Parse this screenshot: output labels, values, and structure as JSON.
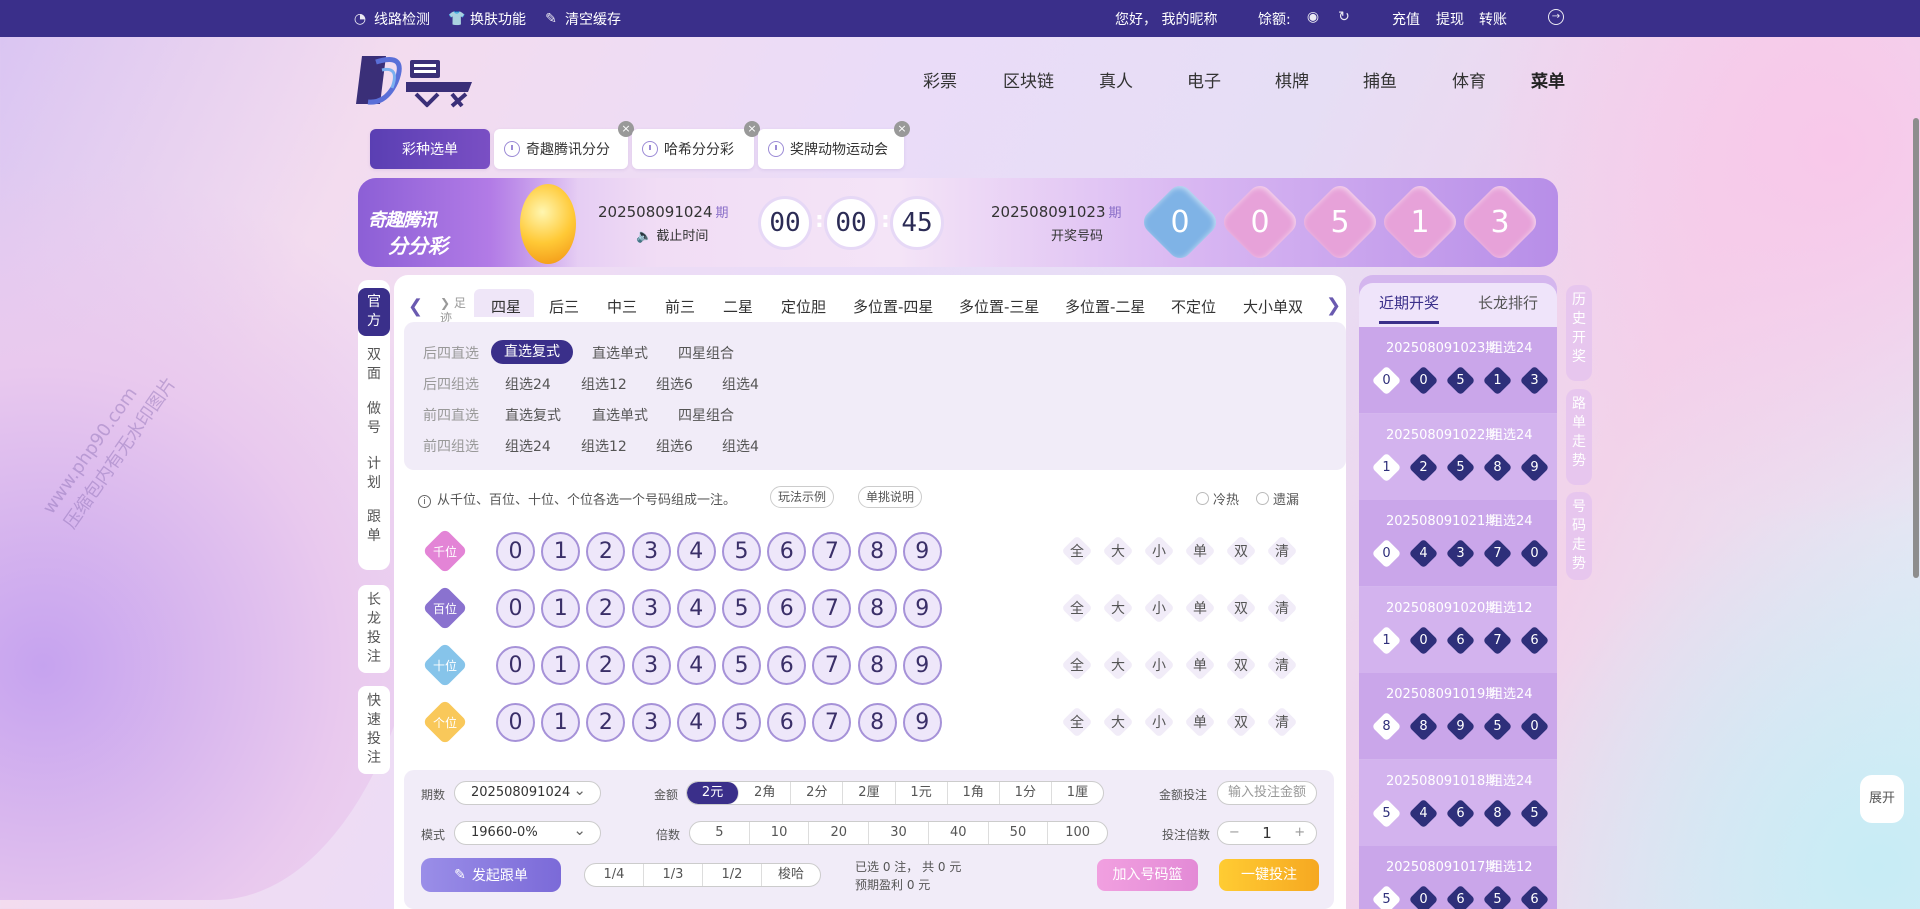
{
  "topbar": {
    "line_check": "线路检测",
    "skin": "换肤功能",
    "clear_cache": "清空缓存",
    "greeting": "您好， 我的昵称",
    "balance_label": "馀额:",
    "recharge": "充值",
    "withdraw": "提现",
    "transfer": "转账"
  },
  "nav": [
    "彩票",
    "区块链",
    "真人",
    "电子",
    "棋牌",
    "捕鱼",
    "体育",
    "菜单"
  ],
  "tabs": {
    "menu": "彩种选单",
    "items": [
      "奇趣腾讯分分",
      "哈希分分彩",
      "奖牌动物运动会"
    ]
  },
  "banner": {
    "logo_line1": "奇趣腾讯",
    "logo_line2": "分分彩",
    "current_issue": "202508091024",
    "issue_suffix": "期",
    "deadline_label": "截止时间",
    "time": [
      "00",
      "00",
      "45"
    ],
    "last_issue": "202508091023",
    "last_label": "开奖号码",
    "draw_numbers": [
      "0",
      "0",
      "5",
      "1",
      "3"
    ],
    "draw_colors": [
      "#7fb3e6",
      "#e7a2d9",
      "#e7a2d9",
      "#e7a2d9",
      "#e7a2d9"
    ]
  },
  "left_side": {
    "active": "官方",
    "items": [
      "双面",
      "做号",
      "计划",
      "跟单"
    ],
    "long_bet": "长龙投注",
    "quick_bet": "快速投注"
  },
  "play_tabs": {
    "footprint": "足迹",
    "items": [
      "四星",
      "后三",
      "中三",
      "前三",
      "二星",
      "定位胆",
      "多位置-四星",
      "多位置-三星",
      "多位置-二星",
      "不定位",
      "大小单双"
    ]
  },
  "sub_plays": {
    "rows": [
      {
        "label": "后四直选",
        "items": [
          "直选复式",
          "直选单式",
          "四星组合"
        ]
      },
      {
        "label": "后四组选",
        "items": [
          "组选24",
          "组选12",
          "组选6",
          "组选4"
        ]
      },
      {
        "label": "前四直选",
        "items": [
          "直选复式",
          "直选单式",
          "四星组合"
        ]
      },
      {
        "label": "前四组选",
        "items": [
          "组选24",
          "组选12",
          "组选6",
          "组选4"
        ]
      }
    ]
  },
  "hint": {
    "text": "从千位、百位、十位、个位各选一个号码组成一注。",
    "example": "玩法示例",
    "explain": "单挑说明",
    "hot_cold": "冷热",
    "missing": "遗漏"
  },
  "positions": [
    {
      "name": "千位",
      "color": "#e384d6"
    },
    {
      "name": "百位",
      "color": "#8a72cf"
    },
    {
      "name": "十位",
      "color": "#86c4ea"
    },
    {
      "name": "个位",
      "color": "#f9c85a"
    }
  ],
  "digits": [
    "0",
    "1",
    "2",
    "3",
    "4",
    "5",
    "6",
    "7",
    "8",
    "9"
  ],
  "quick": [
    "全",
    "大",
    "小",
    "单",
    "双",
    "清"
  ],
  "bottom": {
    "period_label": "期数",
    "period_value": "202508091024",
    "amount_label": "金额",
    "amount_options": [
      "2元",
      "2角",
      "2分",
      "2厘",
      "1元",
      "1角",
      "1分",
      "1厘"
    ],
    "amount_bet_label": "金额投注",
    "amount_placeholder": "输入投注金额",
    "mode_label": "模式",
    "mode_value": "19660-0%",
    "multiple_label": "倍数",
    "multiple_options": [
      "5",
      "10",
      "20",
      "30",
      "40",
      "50",
      "100"
    ],
    "bet_multiple_label": "投注倍数",
    "multiple_minus": "−",
    "multiple_value": "1",
    "multiple_plus": "+",
    "follow_btn": "发起跟单",
    "fraction_options": [
      "1/4",
      "1/3",
      "1/2",
      "梭哈"
    ],
    "selected_text": "已选 0 注， 共 0 元",
    "profit_text": "预期盈利  0 元",
    "add_basket": "加入号码篮",
    "one_click": "一键投注"
  },
  "right_panel": {
    "tab_recent": "近期开奖",
    "tab_long": "长龙排行",
    "history": [
      {
        "issue": "202508091023期",
        "type": "组选24",
        "nums": [
          "0",
          "0",
          "5",
          "1",
          "3"
        ]
      },
      {
        "issue": "202508091022期",
        "type": "组选24",
        "nums": [
          "1",
          "2",
          "5",
          "8",
          "9"
        ]
      },
      {
        "issue": "202508091021期",
        "type": "组选24",
        "nums": [
          "0",
          "4",
          "3",
          "7",
          "0"
        ]
      },
      {
        "issue": "202508091020期",
        "type": "组选12",
        "nums": [
          "1",
          "0",
          "6",
          "7",
          "6"
        ]
      },
      {
        "issue": "202508091019期",
        "type": "组选24",
        "nums": [
          "8",
          "8",
          "9",
          "5",
          "0"
        ]
      },
      {
        "issue": "202508091018期",
        "type": "组选24",
        "nums": [
          "5",
          "4",
          "6",
          "8",
          "5"
        ]
      },
      {
        "issue": "202508091017期",
        "type": "组选12",
        "nums": [
          "5",
          "0",
          "6",
          "5",
          "6"
        ]
      }
    ]
  },
  "right_side": [
    "历史开奖",
    "路单走势",
    "号码走势"
  ],
  "expand": "展开",
  "watermark_line1": "www.php90.com",
  "watermark_line2": "压缩包内有无水印图片"
}
